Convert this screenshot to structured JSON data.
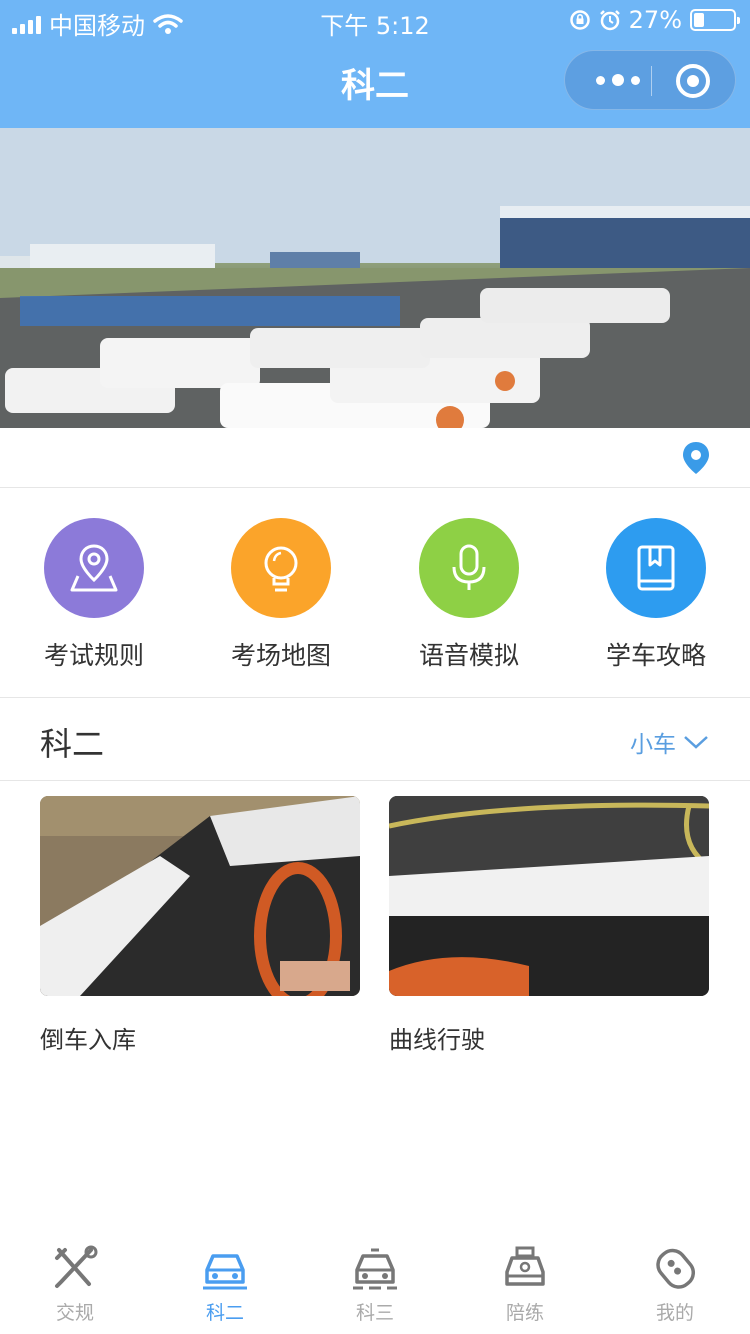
{
  "status_bar": {
    "carrier": "中国移动",
    "time": "下午 5:12",
    "battery": "27%"
  },
  "nav": {
    "title": "科二"
  },
  "features": [
    {
      "label": "考试规则",
      "icon": "map-pin-icon",
      "color": "#8c7ad9"
    },
    {
      "label": "考场地图",
      "icon": "lightbulb-icon",
      "color": "#fba42a"
    },
    {
      "label": "语音模拟",
      "icon": "microphone-icon",
      "color": "#8ed045"
    },
    {
      "label": "学车攻略",
      "icon": "book-icon",
      "color": "#2d9cf0"
    }
  ],
  "section": {
    "title": "科二",
    "vehicle_selected": "小车"
  },
  "cards": [
    {
      "name": "倒车入库"
    },
    {
      "name": "曲线行驶"
    }
  ],
  "tabbar": {
    "items": [
      {
        "label": "交规",
        "icon": "tools-icon",
        "active": false
      },
      {
        "label": "科二",
        "icon": "car-icon",
        "active": true
      },
      {
        "label": "科三",
        "icon": "car-road-icon",
        "active": false
      },
      {
        "label": "陪练",
        "icon": "taxi-icon",
        "active": false
      },
      {
        "label": "我的",
        "icon": "car-key-icon",
        "active": false
      }
    ]
  },
  "colors": {
    "accent": "#4a9df0",
    "header": "#6fb6f6"
  }
}
